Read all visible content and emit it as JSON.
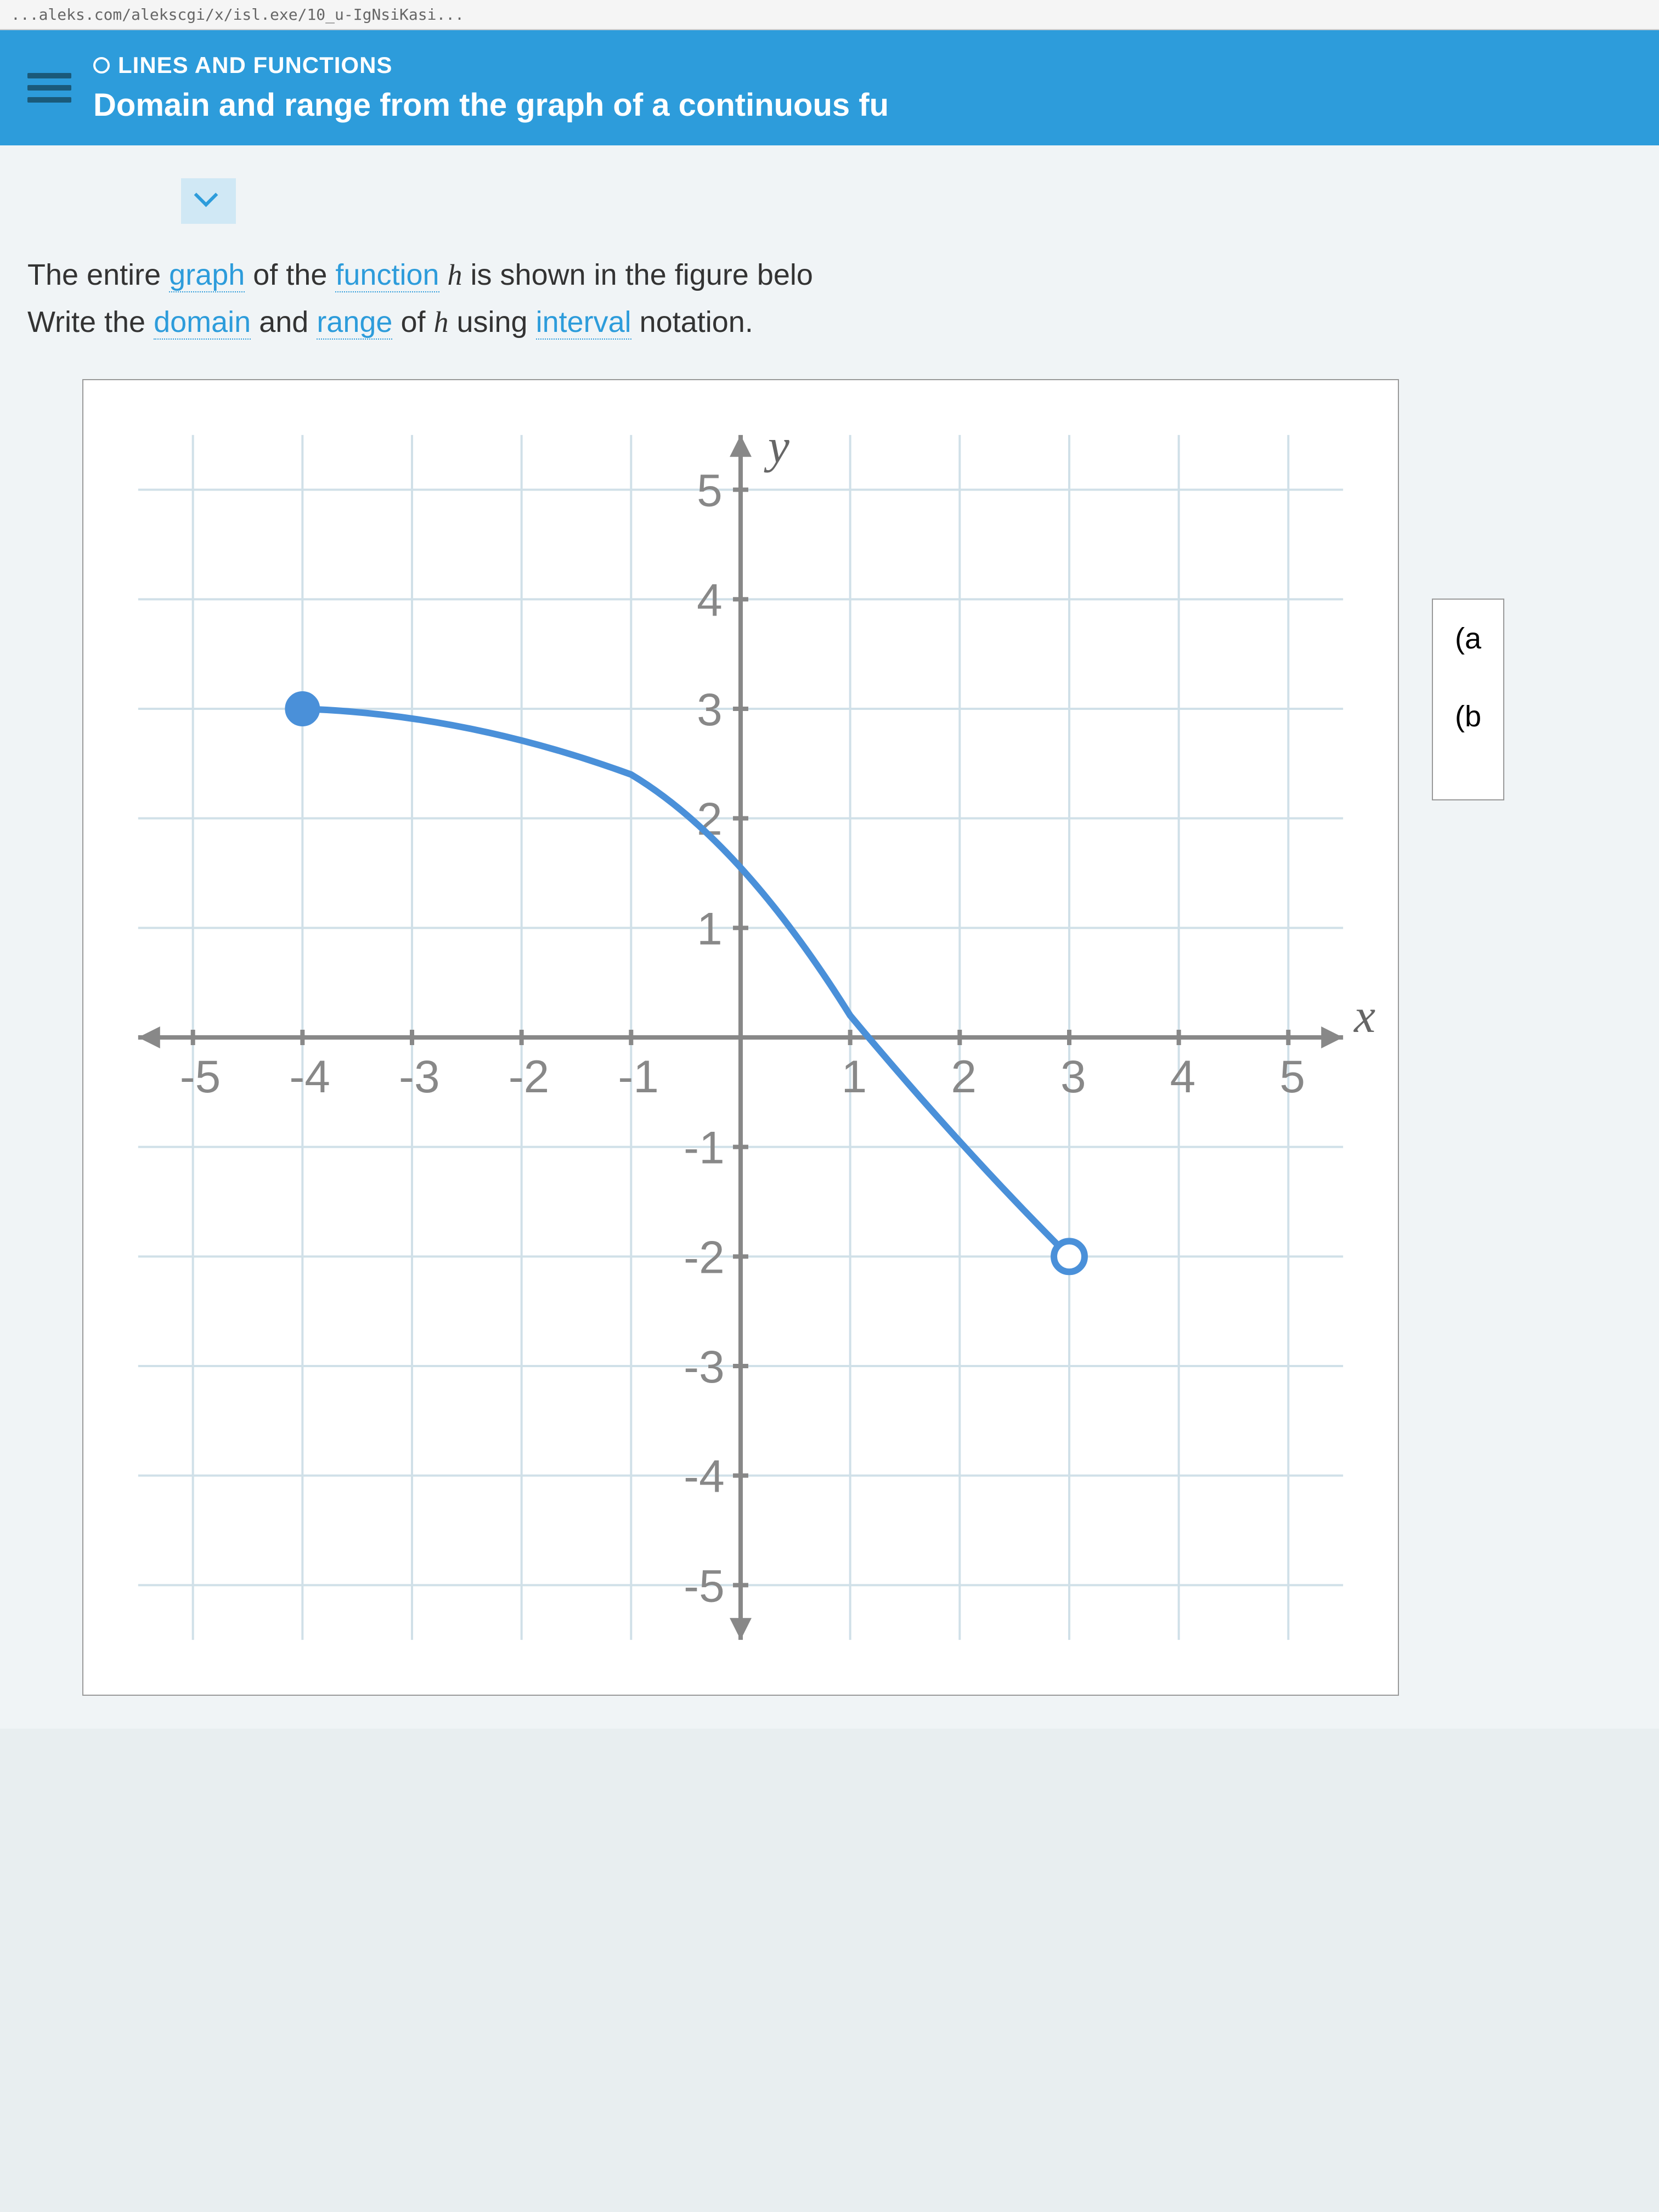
{
  "url_fragment": "...aleks.com/alekscgi/x/isl.exe/10_u-IgNsiKasi...",
  "header": {
    "category": "LINES AND FUNCTIONS",
    "title": "Domain and range from the graph of a continuous fu"
  },
  "problem": {
    "line1_part1": "The entire ",
    "line1_graph": "graph",
    "line1_part2": " of the ",
    "line1_function": "function",
    "line1_part3": " ",
    "line1_h": "h",
    "line1_part4": " is shown in the figure belo",
    "line2_part1": "Write the ",
    "line2_domain": "domain",
    "line2_part2": " and ",
    "line2_range": "range",
    "line2_part3": " of ",
    "line2_h": "h",
    "line2_part4": " using ",
    "line2_interval": "interval",
    "line2_part5": " notation."
  },
  "answers": {
    "a_label": "(a",
    "b_label": "(b"
  },
  "chart_data": {
    "type": "line",
    "title": "",
    "xlabel": "x",
    "ylabel": "y",
    "xlim": [
      -5.5,
      5.5
    ],
    "ylim": [
      -5.5,
      5.5
    ],
    "x_ticks": [
      -5,
      -4,
      -3,
      -2,
      -1,
      1,
      2,
      3,
      4,
      5
    ],
    "y_ticks": [
      -5,
      -4,
      -3,
      -2,
      -1,
      1,
      2,
      3,
      4,
      5
    ],
    "series": [
      {
        "name": "h",
        "points": [
          {
            "x": -4,
            "y": 3,
            "type": "closed"
          },
          {
            "x": -3,
            "y": 2.95
          },
          {
            "x": -2,
            "y": 2.8
          },
          {
            "x": -1,
            "y": 2.4
          },
          {
            "x": 0,
            "y": 1.5
          },
          {
            "x": 1,
            "y": 0.2
          },
          {
            "x": 2,
            "y": -1
          },
          {
            "x": 3,
            "y": -2,
            "type": "open"
          }
        ]
      }
    ]
  }
}
